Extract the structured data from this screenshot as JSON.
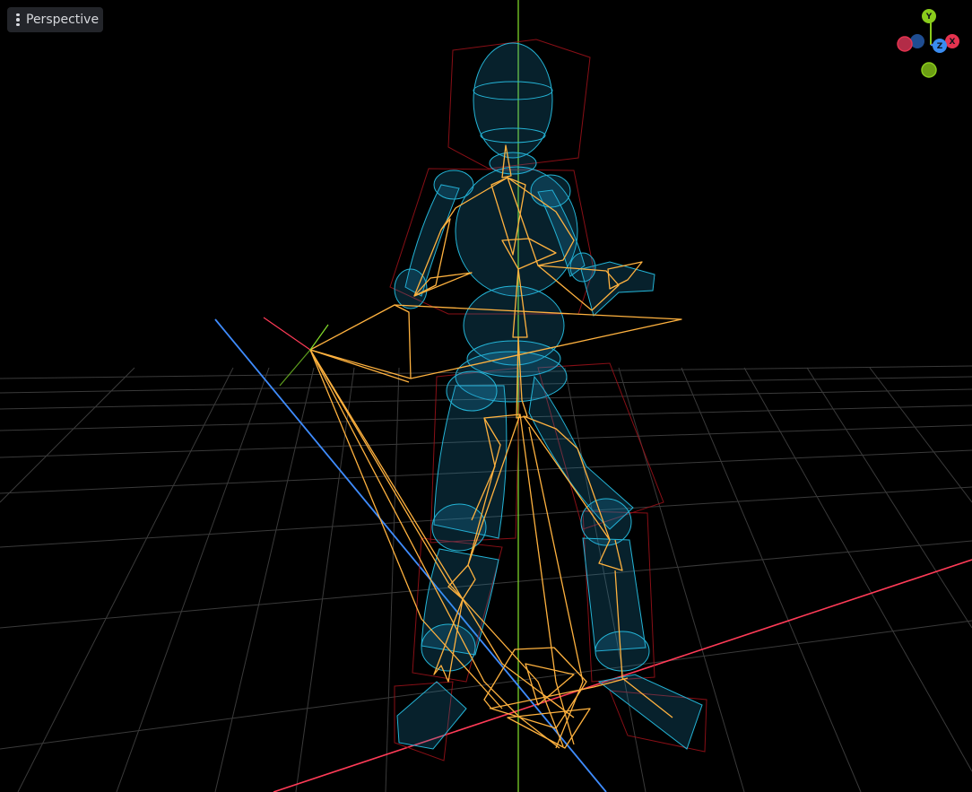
{
  "viewport": {
    "view_menu_icon": "kebab-menu-icon",
    "view_mode": "Perspective",
    "scene": "ragdoll-skeleton-wireframe",
    "axis_colors": {
      "x": "#ff3b57",
      "y": "#86e12b",
      "z": "#3f8cff"
    },
    "bone_color": "#ffb23f",
    "collision_shape_color": "#24b4d6",
    "bounds_color": "#a0121a",
    "grid_color": "#6a6a6a"
  },
  "gizmo": {
    "y_label": "Y",
    "z_label": "Z",
    "x_label": "X",
    "colors": {
      "x": "#e5334f",
      "y": "#8acc1c",
      "z": "#3a8cf0",
      "neg_x": "#b32c47",
      "neg_y": "#6c9f13",
      "neg_z": "#1f4d91"
    }
  }
}
